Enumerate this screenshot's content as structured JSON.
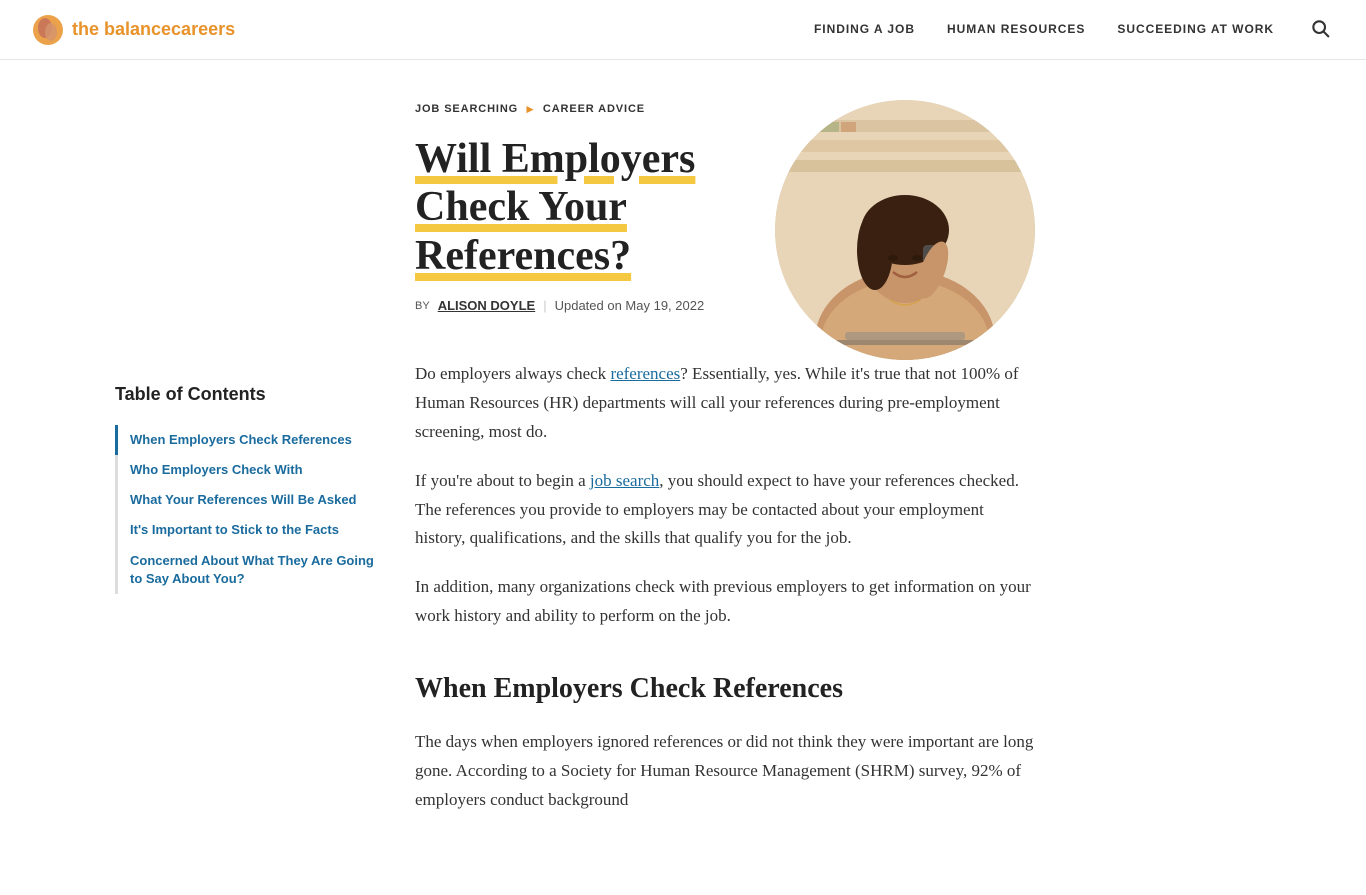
{
  "header": {
    "logo_text_before": "the balance",
    "logo_text_after": "careers",
    "nav_items": [
      {
        "label": "FINDING A JOB",
        "url": "#"
      },
      {
        "label": "HUMAN RESOURCES",
        "url": "#"
      },
      {
        "label": "SUCCEEDING AT WORK",
        "url": "#"
      }
    ]
  },
  "breadcrumb": {
    "items": [
      {
        "label": "JOB SEARCHING",
        "url": "#"
      },
      {
        "label": "CAREER ADVICE",
        "url": "#"
      }
    ]
  },
  "article": {
    "title": "Will Employers Check Your References?",
    "author_label": "BY",
    "author_name": "ALISON DOYLE",
    "updated": "Updated on May 19, 2022",
    "intro_p1": "Do employers always check references? Essentially, yes. While it's true that not 100% of Human Resources (HR) departments will call your references during pre-employment screening, most do.",
    "intro_p2": "If you're about to begin a job search, you should expect to have your references checked. The references you provide to employers may be contacted about your employment history, qualifications, and the skills that qualify you for the job.",
    "intro_p3": "In addition, many organizations check with previous employers to get information on your work history and ability to perform on the job.",
    "section1_heading": "When Employers Check References",
    "section1_p1": "The days when employers ignored references or did not think they were important are long gone. According to a Society for Human Resource Management (SHRM) survey, 92% of employers conduct background",
    "references_link": "references",
    "job_search_link": "job search"
  },
  "toc": {
    "title": "Table of Contents",
    "items": [
      {
        "label": "When Employers Check References",
        "url": "#",
        "active": true
      },
      {
        "label": "Who Employers Check With",
        "url": "#",
        "active": false
      },
      {
        "label": "What Your References Will Be Asked",
        "url": "#",
        "active": false
      },
      {
        "label": "It's Important to Stick to the Facts",
        "url": "#",
        "active": false
      },
      {
        "label": "Concerned About What They Are Going to Say About You?",
        "url": "#",
        "active": false
      }
    ]
  },
  "colors": {
    "accent_orange": "#e8922a",
    "accent_yellow": "#f5c842",
    "link_blue": "#1a6b9e",
    "text_dark": "#222",
    "text_mid": "#333"
  }
}
